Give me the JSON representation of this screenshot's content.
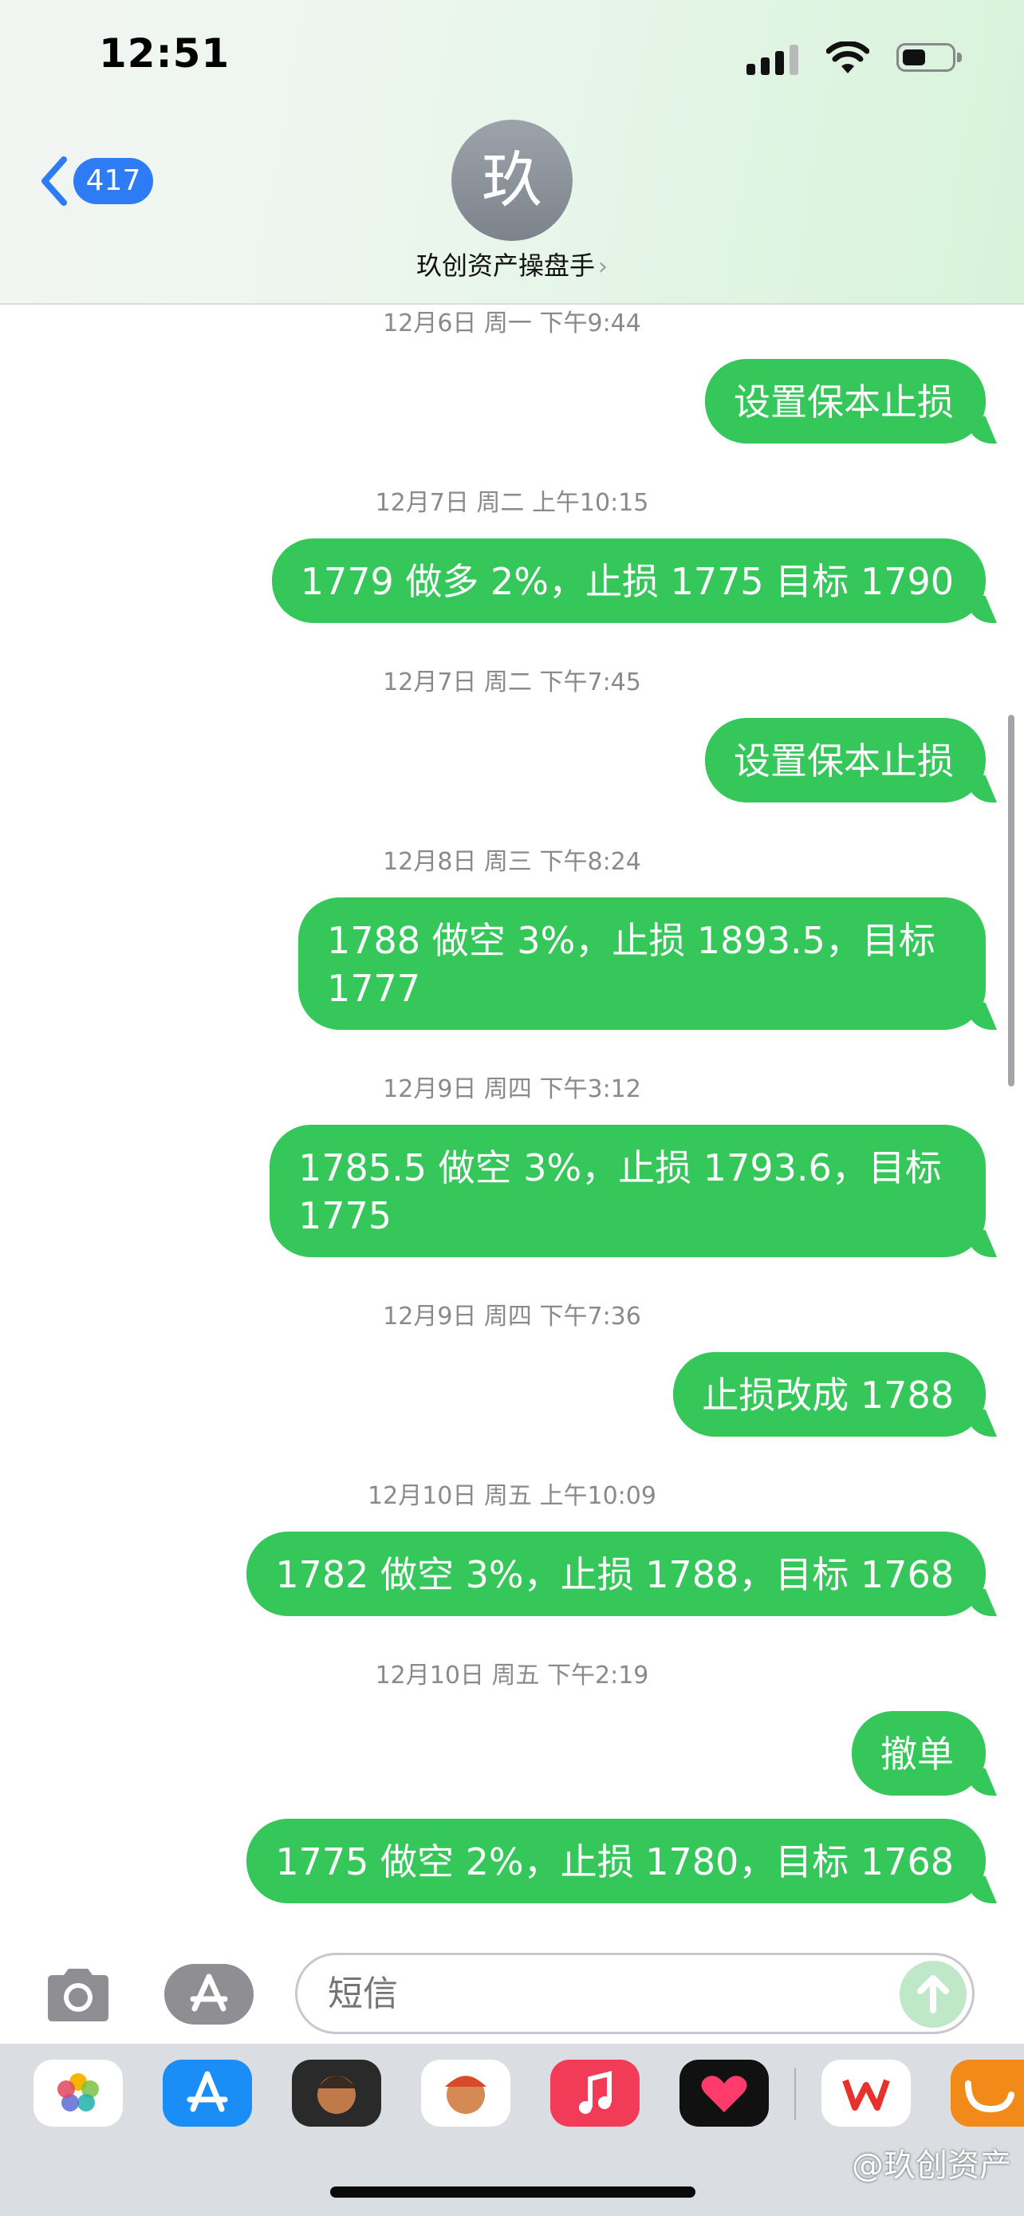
{
  "status_bar": {
    "time": "12:51"
  },
  "header": {
    "back_count": "417",
    "avatar_initial": "玖",
    "contact_name": "玖创资产操盘手",
    "contact_chevron": "›"
  },
  "messages": [
    {
      "timestamp": {
        "date": "12月6日 周一",
        "time": "下午9:44"
      },
      "text": "设置保本止损"
    },
    {
      "timestamp": {
        "date": "12月7日 周二",
        "time": "上午10:15"
      },
      "text": "1779 做多 2%，止损 1775 目标 1790"
    },
    {
      "timestamp": {
        "date": "12月7日 周二",
        "time": "下午7:45"
      },
      "text": "设置保本止损"
    },
    {
      "timestamp": {
        "date": "12月8日 周三",
        "time": "下午8:24"
      },
      "text": "1788 做空 3%，止损 1893.5，目标 1777"
    },
    {
      "timestamp": {
        "date": "12月9日 周四",
        "time": "下午3:12"
      },
      "text": "1785.5 做空 3%，止损 1793.6，目标 1775"
    },
    {
      "timestamp": {
        "date": "12月9日 周四",
        "time": "下午7:36"
      },
      "text": "止损改成 1788"
    },
    {
      "timestamp": {
        "date": "12月10日 周五",
        "time": "上午10:09"
      },
      "text": "1782 做空 3%，止损 1788，目标 1768"
    },
    {
      "timestamp": {
        "date": "12月10日 周五",
        "time": "下午2:19"
      },
      "text": "撤单"
    },
    {
      "text": "1775 做空 2%，止损 1780，目标 1768"
    }
  ],
  "input": {
    "placeholder": "短信"
  },
  "tray": {
    "apps": [
      "photos-icon",
      "app-store-icon",
      "memoji-icon",
      "animoji-icon",
      "music-icon",
      "digital-touch-icon",
      "wps-icon",
      "uc-browser-icon"
    ],
    "watermark": "@玖创资产"
  },
  "colors": {
    "bubble": "#35c759",
    "badge": "#2d7cf6",
    "timestamp": "#8a8a8e"
  }
}
